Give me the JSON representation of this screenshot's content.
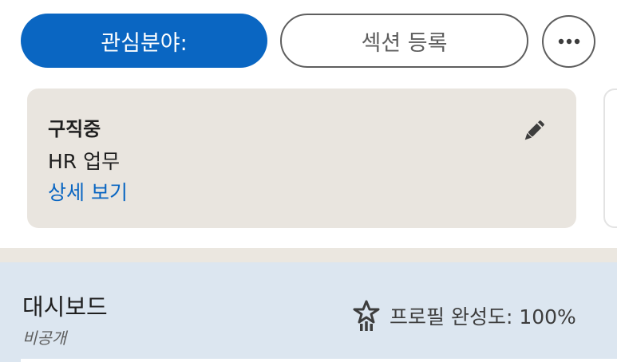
{
  "actions": {
    "interests_label": "관심분야:",
    "add_section_label": "섹션 등록",
    "more_icon": "ellipsis-horizontal-icon"
  },
  "job_card": {
    "status": "구직중",
    "role": "HR 업무",
    "details_link": "상세 보기",
    "edit_icon": "pencil-icon"
  },
  "dashboard": {
    "title": "대시보드",
    "visibility": "비공개",
    "profile_completion": "프로필 완성도: 100%",
    "completion_icon": "star-medal-icon"
  },
  "colors": {
    "brand_blue": "#0a66c2",
    "card_bg": "#e9e5df",
    "dashboard_bg": "#dce6f0"
  }
}
